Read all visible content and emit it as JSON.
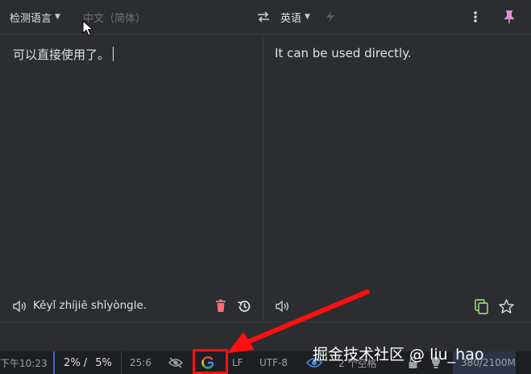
{
  "toolbar": {
    "source_lang": "检测语言",
    "detected_lang": "中文（简体）",
    "target_lang": "英语",
    "icons": [
      "swap-icon",
      "flash-icon",
      "more-vert-icon",
      "pin-icon",
      "caret-down-icon"
    ]
  },
  "source": {
    "text": "可以直接使用了。",
    "pinyin": "Kěyǐ zhíjiē shǐyòngle.",
    "icons": [
      "speaker-icon",
      "trash-icon",
      "history-icon"
    ]
  },
  "target": {
    "text": "It can be used directly.",
    "icons": [
      "speaker-icon",
      "copy-icon",
      "star-icon"
    ]
  },
  "statusbar": {
    "time": "下午10:23",
    "progress_a": "2%",
    "progress_b": "5%",
    "separator": "/",
    "position": "25:6",
    "line_ending": "LF",
    "encoding": "UTF-8",
    "indent": "2 个空格",
    "memory": "380/2100M",
    "icons": [
      "inspection-icon",
      "google-icon",
      "eye-icon",
      "lock-icon",
      "bulb-icon"
    ]
  },
  "watermark": "掘金技术社区 @ liu_hao",
  "colors": {
    "panel_bg": "#2b2d30",
    "status_bg": "#1e1f22",
    "text": "#dfe1e5",
    "dim_text": "#6f737a",
    "accent_pink": "#e08dd5",
    "trash_red": "#ff6b7a",
    "copy_green": "#9ccd76",
    "annotation_red": "#ff1010"
  }
}
